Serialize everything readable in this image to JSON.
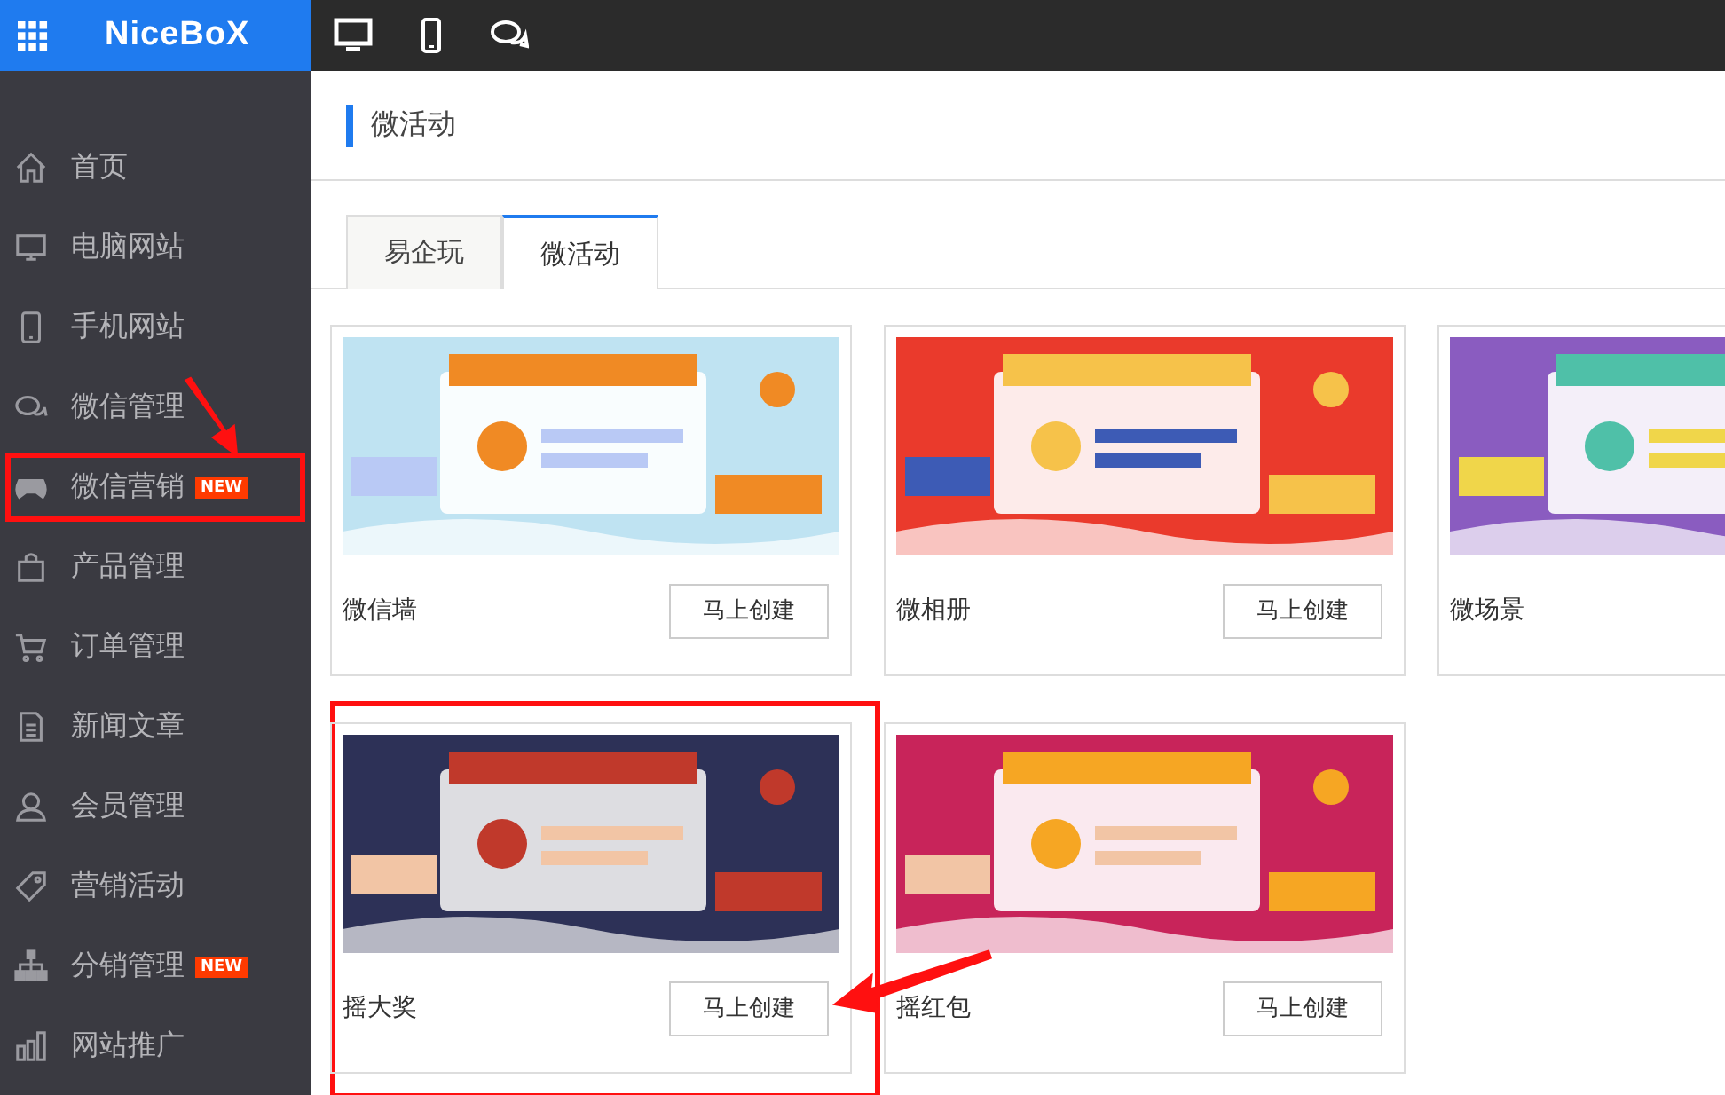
{
  "logo": "NiceBoX",
  "sidebar": {
    "items": [
      {
        "label": "首页",
        "highlighted": false
      },
      {
        "label": "电脑网站",
        "highlighted": false
      },
      {
        "label": "手机网站",
        "highlighted": false
      },
      {
        "label": "微信管理",
        "highlighted": false
      },
      {
        "label": "微信营销",
        "badge": "NEW",
        "highlighted": true
      },
      {
        "label": "产品管理",
        "highlighted": false
      },
      {
        "label": "订单管理",
        "highlighted": false
      },
      {
        "label": "新闻文章",
        "highlighted": false
      },
      {
        "label": "会员管理",
        "highlighted": false
      },
      {
        "label": "营销活动",
        "highlighted": false
      },
      {
        "label": "分销管理",
        "badge": "NEW",
        "highlighted": false
      },
      {
        "label": "网站推广",
        "highlighted": false
      }
    ]
  },
  "page_title": "微活动",
  "tabs": [
    {
      "label": "易企玩",
      "selected": false
    },
    {
      "label": "微活动",
      "selected": true
    }
  ],
  "cards": [
    {
      "title": "微信墙",
      "button": "马上创建",
      "highlighted": false
    },
    {
      "title": "微相册",
      "button": "马上创建",
      "highlighted": false
    },
    {
      "title": "微场景",
      "highlighted": false
    },
    {
      "title": "摇大奖",
      "button": "马上创建",
      "highlighted": true
    },
    {
      "title": "摇红包",
      "button": "马上创建",
      "highlighted": false
    }
  ]
}
